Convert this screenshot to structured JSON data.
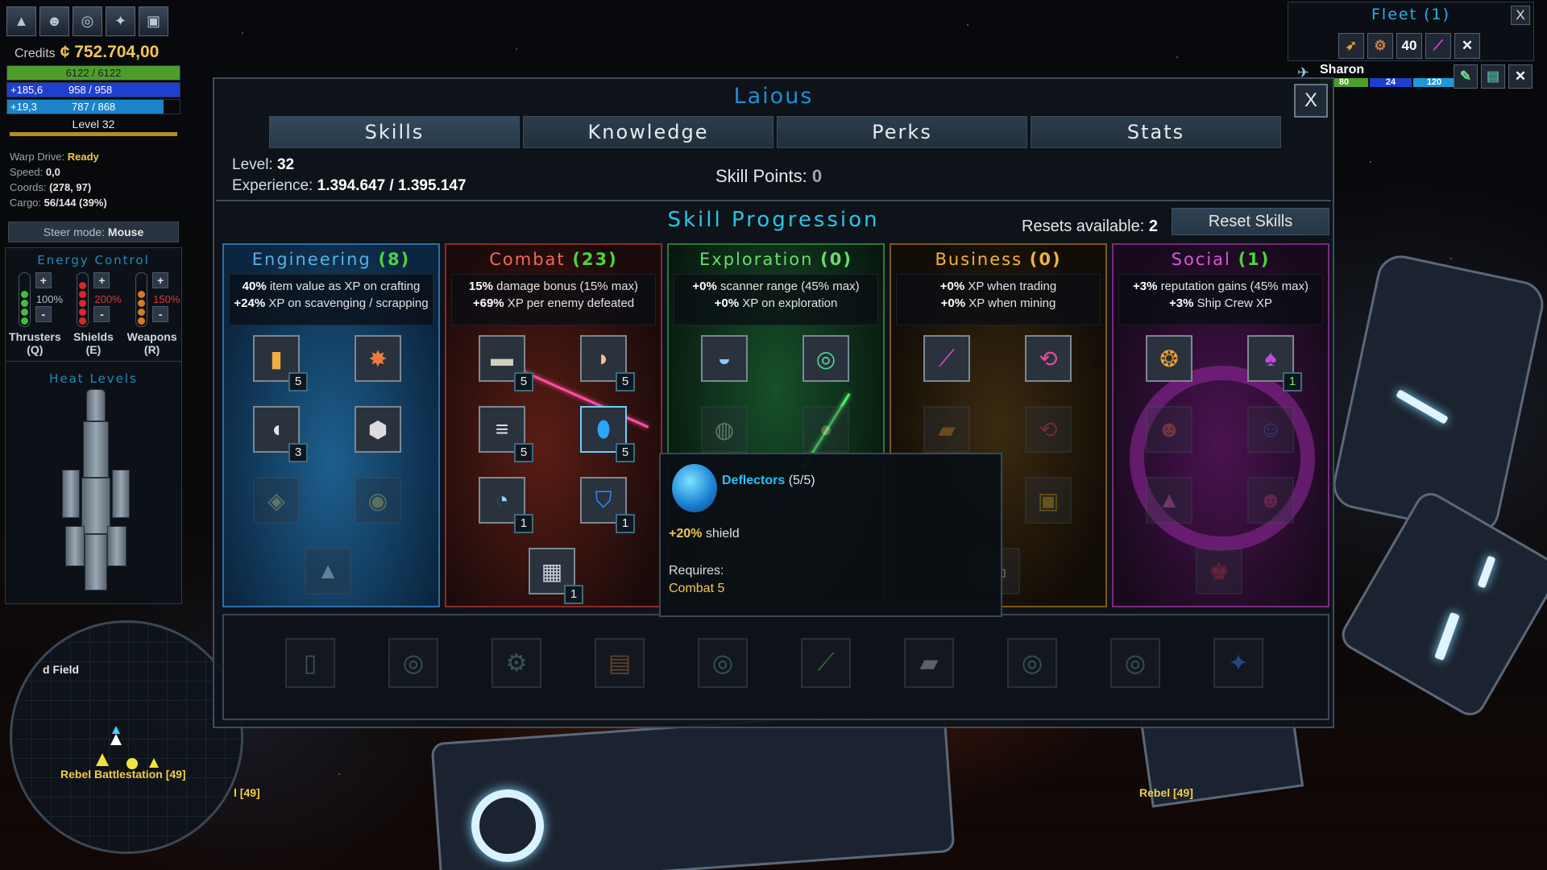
{
  "hud": {
    "credits_label": "Credits",
    "credits_value": "¢ 752.704,00",
    "hull": "6122 / 6122",
    "shield_regen": "+185,6",
    "shield": "958 / 958",
    "energy_regen": "+19,3",
    "energy": "787 / 868",
    "level": "Level 32",
    "warp_label": "Warp Drive:",
    "warp_value": "Ready",
    "speed_label": "Speed:",
    "speed_value": "0,0",
    "coords_label": "Coords:",
    "coords_value": "(278, 97)",
    "cargo_label": "Cargo:",
    "cargo_value": "56/144 (39%)",
    "steer_label": "Steer mode:",
    "steer_value": "Mouse",
    "energy_control_title": "Energy Control",
    "thrusters_pct": "100%",
    "shields_pct": "200%",
    "weapons_pct": "150%",
    "thrusters_label": "Thrusters",
    "thrusters_key": "(Q)",
    "shields_label": "Shields",
    "shields_key": "(E)",
    "weapons_label": "Weapons",
    "weapons_key": "(R)",
    "heat_title": "Heat Levels",
    "plus": "+",
    "minus": "-",
    "colors": {
      "hull": "#4c9e2a",
      "shield": "#1f3fd0",
      "energy": "#1b84c9",
      "xp": "#b48f1f"
    }
  },
  "minimap": {
    "field_label": "d Field",
    "station_label": "Rebel Battlestation [49]"
  },
  "world": {
    "rebel_left": "l [49]",
    "rebel_right": "Rebel [49]"
  },
  "fleet": {
    "title": "Fleet (1)",
    "close": "X",
    "count_badge": "40",
    "member_name": "Sharon",
    "member_hull": "80",
    "member_shield": "24",
    "member_energy": "120"
  },
  "dialog": {
    "title": "Laious",
    "close": "X",
    "tabs": [
      "Skills",
      "Knowledge",
      "Perks",
      "Stats"
    ],
    "level_label": "Level:",
    "level_value": "32",
    "xp_label": "Experience:",
    "xp_value": "1.394.647 / 1.395.147",
    "skill_points_label": "Skill Points:",
    "skill_points_value": "0",
    "progression_title": "Skill Progression",
    "resets_label": "Resets available:",
    "resets_value": "2",
    "reset_button": "Reset Skills"
  },
  "trees": [
    {
      "name": "Engineering",
      "count": "(8)",
      "color": "#5ab0e8",
      "count_color": "#4cd43a",
      "line1_bold": "40%",
      "line1": " item value as XP on crafting",
      "line2_bold": "+24%",
      "line2": " XP on scavenging / scrapping",
      "ranks": [
        "5",
        "3"
      ]
    },
    {
      "name": "Combat",
      "count": "(23)",
      "color": "#f06a5a",
      "count_color": "#4cd43a",
      "line1_bold": "15%",
      "line1": " damage bonus (15% max)",
      "line2_bold": "+69%",
      "line2": " XP per enemy defeated",
      "ranks": [
        "5",
        "5",
        "5",
        "5",
        "1",
        "1",
        "1"
      ]
    },
    {
      "name": "Exploration",
      "count": "(0)",
      "color": "#6cdc6c",
      "count_color": "#6cdc6c",
      "line1_bold": "+0%",
      "line1": " scanner range (45% max)",
      "line2_bold": "+0%",
      "line2": " XP on exploration",
      "ranks": []
    },
    {
      "name": "Business",
      "count": "(0)",
      "color": "#f0b43c",
      "count_color": "#f0b43c",
      "line1_bold": "+0%",
      "line1": " XP when trading",
      "line2_bold": "+0%",
      "line2": " XP when mining",
      "ranks": []
    },
    {
      "name": "Social",
      "count": "(1)",
      "color": "#d45ad8",
      "count_color": "#4cd43a",
      "line1_bold": "+3%",
      "line1": " reputation gains (45% max)",
      "line2_bold": "+3%",
      "line2": " Ship Crew XP",
      "ranks": [
        "1"
      ]
    }
  ],
  "tooltip": {
    "name": "Deflectors",
    "rank": "(5/5)",
    "effect_value": "+20%",
    "effect_text": " shield",
    "requires_label": "Requires:",
    "requires_value": "Combat 5"
  },
  "icons": {
    "ship": "ship-icon",
    "crew": "crew-icon",
    "radar": "radar-icon",
    "map": "galaxy-map-icon",
    "log": "log-icon"
  }
}
